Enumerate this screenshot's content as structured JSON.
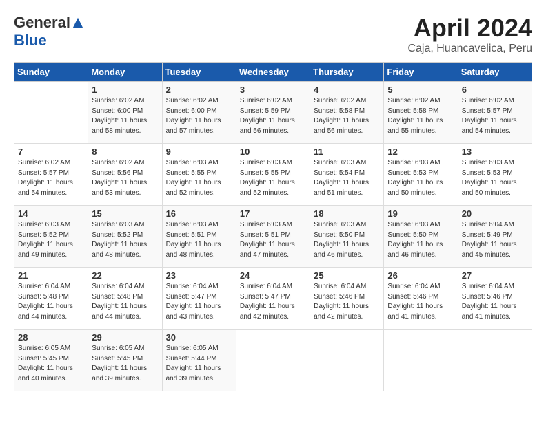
{
  "header": {
    "logo_general": "General",
    "logo_blue": "Blue",
    "month_title": "April 2024",
    "location": "Caja, Huancavelica, Peru"
  },
  "days_of_week": [
    "Sunday",
    "Monday",
    "Tuesday",
    "Wednesday",
    "Thursday",
    "Friday",
    "Saturday"
  ],
  "weeks": [
    [
      {
        "day": "",
        "sunrise": "",
        "sunset": "",
        "daylight": ""
      },
      {
        "day": "1",
        "sunrise": "Sunrise: 6:02 AM",
        "sunset": "Sunset: 6:00 PM",
        "daylight": "Daylight: 11 hours and 58 minutes."
      },
      {
        "day": "2",
        "sunrise": "Sunrise: 6:02 AM",
        "sunset": "Sunset: 6:00 PM",
        "daylight": "Daylight: 11 hours and 57 minutes."
      },
      {
        "day": "3",
        "sunrise": "Sunrise: 6:02 AM",
        "sunset": "Sunset: 5:59 PM",
        "daylight": "Daylight: 11 hours and 56 minutes."
      },
      {
        "day": "4",
        "sunrise": "Sunrise: 6:02 AM",
        "sunset": "Sunset: 5:58 PM",
        "daylight": "Daylight: 11 hours and 56 minutes."
      },
      {
        "day": "5",
        "sunrise": "Sunrise: 6:02 AM",
        "sunset": "Sunset: 5:58 PM",
        "daylight": "Daylight: 11 hours and 55 minutes."
      },
      {
        "day": "6",
        "sunrise": "Sunrise: 6:02 AM",
        "sunset": "Sunset: 5:57 PM",
        "daylight": "Daylight: 11 hours and 54 minutes."
      }
    ],
    [
      {
        "day": "7",
        "sunrise": "Sunrise: 6:02 AM",
        "sunset": "Sunset: 5:57 PM",
        "daylight": "Daylight: 11 hours and 54 minutes."
      },
      {
        "day": "8",
        "sunrise": "Sunrise: 6:02 AM",
        "sunset": "Sunset: 5:56 PM",
        "daylight": "Daylight: 11 hours and 53 minutes."
      },
      {
        "day": "9",
        "sunrise": "Sunrise: 6:03 AM",
        "sunset": "Sunset: 5:55 PM",
        "daylight": "Daylight: 11 hours and 52 minutes."
      },
      {
        "day": "10",
        "sunrise": "Sunrise: 6:03 AM",
        "sunset": "Sunset: 5:55 PM",
        "daylight": "Daylight: 11 hours and 52 minutes."
      },
      {
        "day": "11",
        "sunrise": "Sunrise: 6:03 AM",
        "sunset": "Sunset: 5:54 PM",
        "daylight": "Daylight: 11 hours and 51 minutes."
      },
      {
        "day": "12",
        "sunrise": "Sunrise: 6:03 AM",
        "sunset": "Sunset: 5:53 PM",
        "daylight": "Daylight: 11 hours and 50 minutes."
      },
      {
        "day": "13",
        "sunrise": "Sunrise: 6:03 AM",
        "sunset": "Sunset: 5:53 PM",
        "daylight": "Daylight: 11 hours and 50 minutes."
      }
    ],
    [
      {
        "day": "14",
        "sunrise": "Sunrise: 6:03 AM",
        "sunset": "Sunset: 5:52 PM",
        "daylight": "Daylight: 11 hours and 49 minutes."
      },
      {
        "day": "15",
        "sunrise": "Sunrise: 6:03 AM",
        "sunset": "Sunset: 5:52 PM",
        "daylight": "Daylight: 11 hours and 48 minutes."
      },
      {
        "day": "16",
        "sunrise": "Sunrise: 6:03 AM",
        "sunset": "Sunset: 5:51 PM",
        "daylight": "Daylight: 11 hours and 48 minutes."
      },
      {
        "day": "17",
        "sunrise": "Sunrise: 6:03 AM",
        "sunset": "Sunset: 5:51 PM",
        "daylight": "Daylight: 11 hours and 47 minutes."
      },
      {
        "day": "18",
        "sunrise": "Sunrise: 6:03 AM",
        "sunset": "Sunset: 5:50 PM",
        "daylight": "Daylight: 11 hours and 46 minutes."
      },
      {
        "day": "19",
        "sunrise": "Sunrise: 6:03 AM",
        "sunset": "Sunset: 5:50 PM",
        "daylight": "Daylight: 11 hours and 46 minutes."
      },
      {
        "day": "20",
        "sunrise": "Sunrise: 6:04 AM",
        "sunset": "Sunset: 5:49 PM",
        "daylight": "Daylight: 11 hours and 45 minutes."
      }
    ],
    [
      {
        "day": "21",
        "sunrise": "Sunrise: 6:04 AM",
        "sunset": "Sunset: 5:48 PM",
        "daylight": "Daylight: 11 hours and 44 minutes."
      },
      {
        "day": "22",
        "sunrise": "Sunrise: 6:04 AM",
        "sunset": "Sunset: 5:48 PM",
        "daylight": "Daylight: 11 hours and 44 minutes."
      },
      {
        "day": "23",
        "sunrise": "Sunrise: 6:04 AM",
        "sunset": "Sunset: 5:47 PM",
        "daylight": "Daylight: 11 hours and 43 minutes."
      },
      {
        "day": "24",
        "sunrise": "Sunrise: 6:04 AM",
        "sunset": "Sunset: 5:47 PM",
        "daylight": "Daylight: 11 hours and 42 minutes."
      },
      {
        "day": "25",
        "sunrise": "Sunrise: 6:04 AM",
        "sunset": "Sunset: 5:46 PM",
        "daylight": "Daylight: 11 hours and 42 minutes."
      },
      {
        "day": "26",
        "sunrise": "Sunrise: 6:04 AM",
        "sunset": "Sunset: 5:46 PM",
        "daylight": "Daylight: 11 hours and 41 minutes."
      },
      {
        "day": "27",
        "sunrise": "Sunrise: 6:04 AM",
        "sunset": "Sunset: 5:46 PM",
        "daylight": "Daylight: 11 hours and 41 minutes."
      }
    ],
    [
      {
        "day": "28",
        "sunrise": "Sunrise: 6:05 AM",
        "sunset": "Sunset: 5:45 PM",
        "daylight": "Daylight: 11 hours and 40 minutes."
      },
      {
        "day": "29",
        "sunrise": "Sunrise: 6:05 AM",
        "sunset": "Sunset: 5:45 PM",
        "daylight": "Daylight: 11 hours and 39 minutes."
      },
      {
        "day": "30",
        "sunrise": "Sunrise: 6:05 AM",
        "sunset": "Sunset: 5:44 PM",
        "daylight": "Daylight: 11 hours and 39 minutes."
      },
      {
        "day": "",
        "sunrise": "",
        "sunset": "",
        "daylight": ""
      },
      {
        "day": "",
        "sunrise": "",
        "sunset": "",
        "daylight": ""
      },
      {
        "day": "",
        "sunrise": "",
        "sunset": "",
        "daylight": ""
      },
      {
        "day": "",
        "sunrise": "",
        "sunset": "",
        "daylight": ""
      }
    ]
  ]
}
